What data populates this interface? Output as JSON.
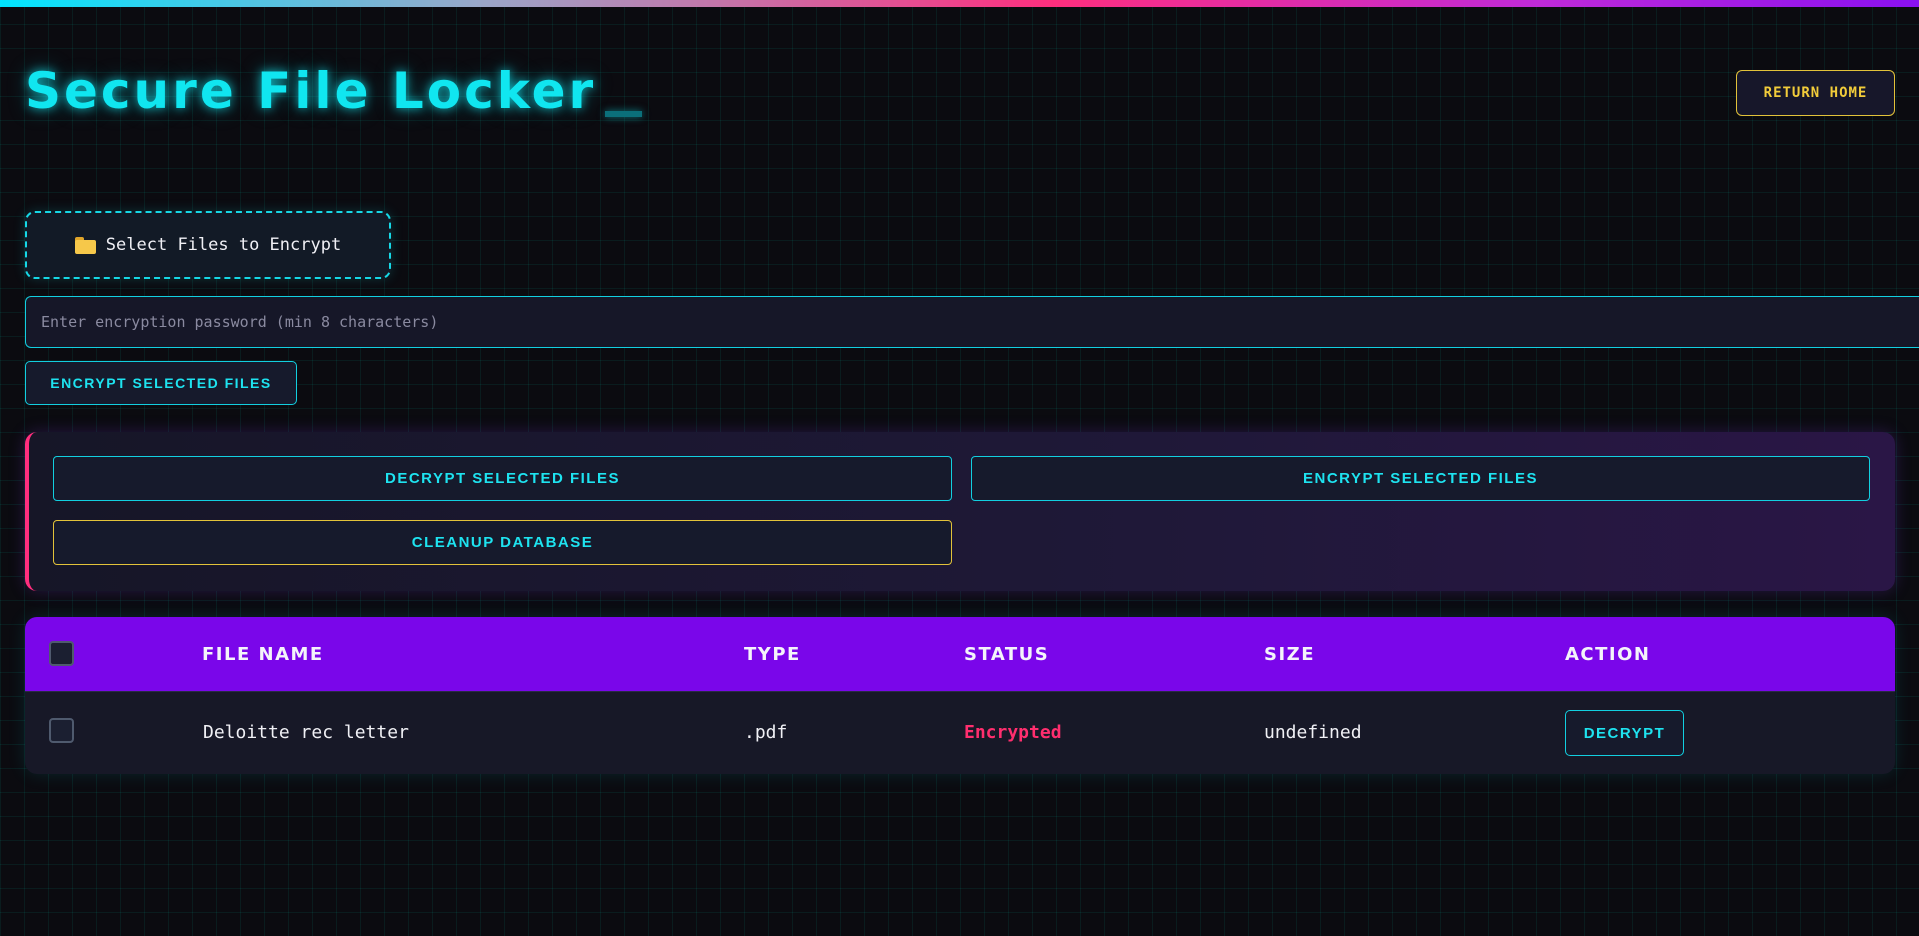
{
  "header": {
    "title": "Secure File Locker",
    "return_home_label": "RETURN HOME"
  },
  "upload": {
    "select_files_label": "Select Files to Encrypt",
    "icon": "folder-icon"
  },
  "password": {
    "placeholder": "Enter encryption password (min 8 characters)",
    "value": ""
  },
  "encrypt_button_label": "ENCRYPT SELECTED FILES",
  "actions": {
    "decrypt_selected_label": "DECRYPT SELECTED FILES",
    "encrypt_selected_label": "ENCRYPT SELECTED FILES",
    "cleanup_label": "CLEANUP DATABASE"
  },
  "table": {
    "columns": [
      "FILE NAME",
      "TYPE",
      "STATUS",
      "SIZE",
      "ACTION"
    ],
    "rows": [
      {
        "file_name": "Deloitte rec letter",
        "type": ".pdf",
        "status": "Encrypted",
        "size": "undefined",
        "action_label": "DECRYPT"
      }
    ]
  },
  "colors": {
    "accent_cyan": "#10e6f0",
    "accent_pink": "#ff2e7e",
    "accent_yellow": "#e2c23a",
    "table_header": "#7a06ea",
    "background": "#0b0b10"
  }
}
